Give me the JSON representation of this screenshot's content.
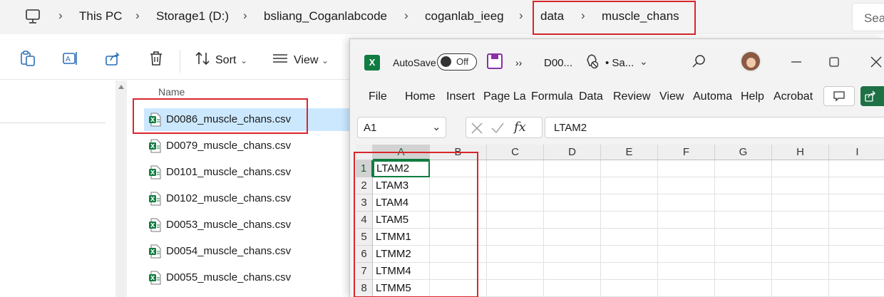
{
  "explorer": {
    "breadcrumbs": [
      "This PC",
      "Storage1 (D:)",
      "bsliang_Coganlabcode",
      "coganlab_ieeg",
      "data",
      "muscle_chans"
    ],
    "search_placeholder": "Sea",
    "toolbar": {
      "sort_label": "Sort",
      "view_label": "View"
    },
    "column_name": "Name",
    "files": [
      "D0086_muscle_chans.csv",
      "D0079_muscle_chans.csv",
      "D0101_muscle_chans.csv",
      "D0102_muscle_chans.csv",
      "D0053_muscle_chans.csv",
      "D0054_muscle_chans.csv",
      "D0055_muscle_chans.csv"
    ],
    "selected_index": 0
  },
  "excel": {
    "logo_letter": "X",
    "autosave_label": "AutoSave",
    "autosave_state": "Off",
    "overflow": "››",
    "doc_name": "D00...",
    "save_status": "• Sa...",
    "ribbon_tabs": [
      "File",
      "Home",
      "Insert",
      "Page La",
      "Formula",
      "Data",
      "Review",
      "View",
      "Automa",
      "Help",
      "Acrobat"
    ],
    "name_box": "A1",
    "formula": "LTAM2",
    "columns": [
      "A",
      "B",
      "C",
      "D",
      "E",
      "F",
      "G",
      "H",
      "I"
    ],
    "rows": [
      1,
      2,
      3,
      4,
      5,
      6,
      7,
      8
    ],
    "col_a": [
      "LTAM2",
      "LTAM3",
      "LTAM4",
      "LTAM5",
      "LTMM1",
      "LTMM2",
      "LTMM4",
      "LTMM5"
    ],
    "accent": "#107c41"
  },
  "highlight_color": "#d9262c"
}
